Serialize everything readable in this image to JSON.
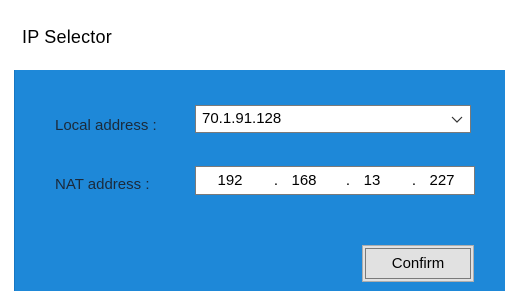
{
  "window": {
    "title": "IP Selector"
  },
  "form": {
    "local_label": "Local address :",
    "local_value": "70.1.91.128",
    "nat_label": "NAT address :",
    "nat_octets": [
      "192",
      "168",
      "13",
      "227"
    ],
    "separator": "."
  },
  "buttons": {
    "confirm_label": "Confirm"
  },
  "icons": {
    "dropdown": "chevron-down-icon"
  },
  "colors": {
    "client_background": "#1e88d8",
    "button_face": "#e1e1e1"
  }
}
